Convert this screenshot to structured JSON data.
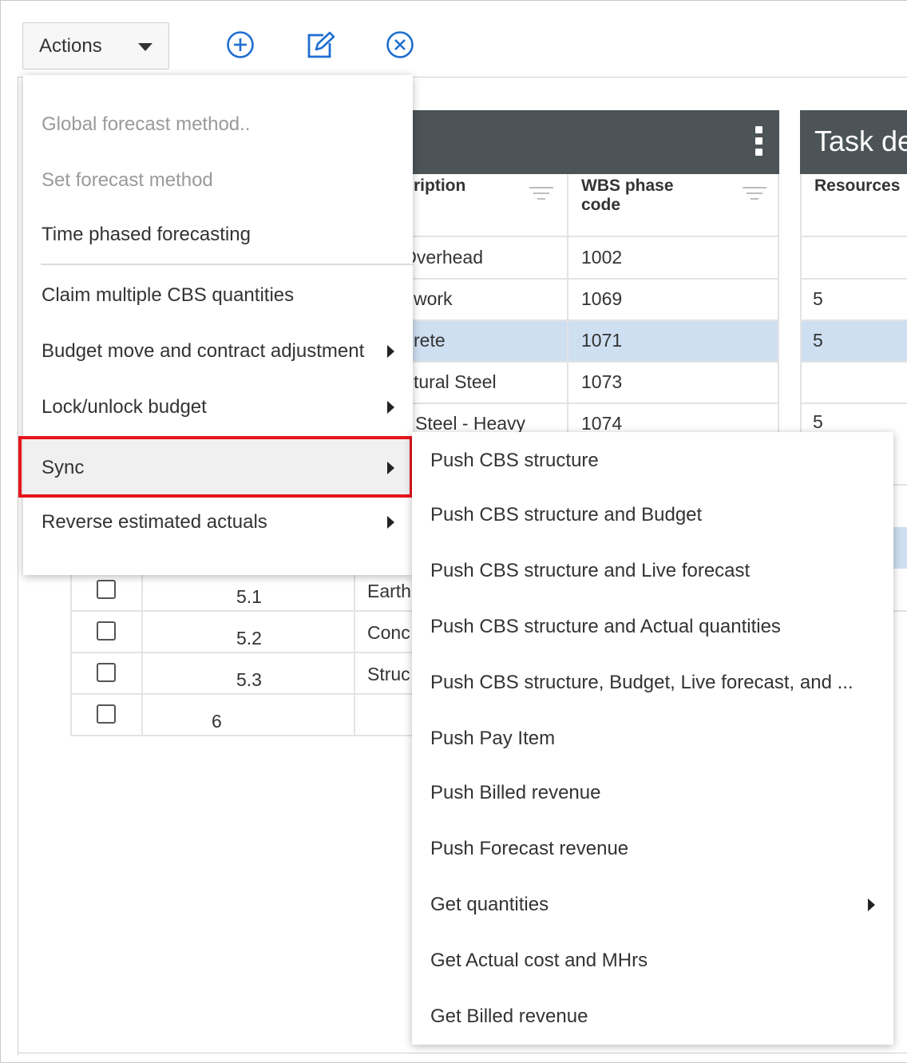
{
  "toolbar": {
    "actions_label": "Actions",
    "icons": [
      "add-circle-icon",
      "edit-icon",
      "close-circle-icon"
    ]
  },
  "grid": {
    "columns": {
      "description": "ription",
      "wbs_phase_code_line1": "WBS phase",
      "wbs_phase_code_line2": "code"
    },
    "rows": [
      {
        "description": "Overhead",
        "wbs": "1002",
        "resources": ""
      },
      {
        "description": "work",
        "wbs": "1069",
        "resources": "5"
      },
      {
        "description": "rete",
        "wbs": "1071",
        "resources": "5"
      },
      {
        "description": "tural Steel",
        "wbs": "1073",
        "resources": ""
      },
      {
        "description": "Steel - Heavy",
        "wbs": "1074",
        "resources": "5"
      }
    ],
    "lower_rows": [
      {
        "id": "5.1",
        "description": "Earth"
      },
      {
        "id": "5.2",
        "description": "Conc"
      },
      {
        "id": "5.3",
        "description": "Struc"
      },
      {
        "id": "6",
        "description": ""
      }
    ]
  },
  "task_panel": {
    "title": "Task de",
    "resources_header": "Resources"
  },
  "actions_menu": {
    "items": [
      {
        "label": "Global forecast method..",
        "disabled": true,
        "submenu": false
      },
      {
        "label": "Set forecast method",
        "disabled": true,
        "submenu": false
      },
      {
        "label": "Time phased forecasting",
        "disabled": false,
        "submenu": false
      },
      {
        "label": "Claim multiple CBS quantities",
        "disabled": false,
        "submenu": false
      },
      {
        "label": "Budget move and contract adjustment",
        "disabled": false,
        "submenu": true
      },
      {
        "label": "Lock/unlock budget",
        "disabled": false,
        "submenu": true
      },
      {
        "label": "Sync",
        "disabled": false,
        "submenu": true,
        "highlighted": true
      },
      {
        "label": "Reverse estimated actuals",
        "disabled": false,
        "submenu": true
      }
    ]
  },
  "sync_submenu": {
    "items": [
      {
        "label": "Push CBS structure",
        "submenu": false
      },
      {
        "label": "Push CBS structure and Budget",
        "submenu": false
      },
      {
        "label": "Push CBS structure and Live forecast",
        "submenu": false
      },
      {
        "label": "Push CBS structure and Actual quantities",
        "submenu": false
      },
      {
        "label": "Push CBS structure, Budget, Live forecast, and ...",
        "submenu": false
      },
      {
        "label": "Push Pay Item",
        "submenu": false
      },
      {
        "label": "Push Billed revenue",
        "submenu": false
      },
      {
        "label": "Push Forecast revenue",
        "submenu": false
      },
      {
        "label": "Get quantities",
        "submenu": true
      },
      {
        "label": "Get Actual cost and MHrs",
        "submenu": false
      },
      {
        "label": "Get Billed revenue",
        "submenu": false
      }
    ]
  },
  "colors": {
    "grid_header": "#4c5457",
    "selected_row": "#cfdff2",
    "highlight_border": "#e8141b",
    "icon_blue": "#1f6fd1"
  }
}
